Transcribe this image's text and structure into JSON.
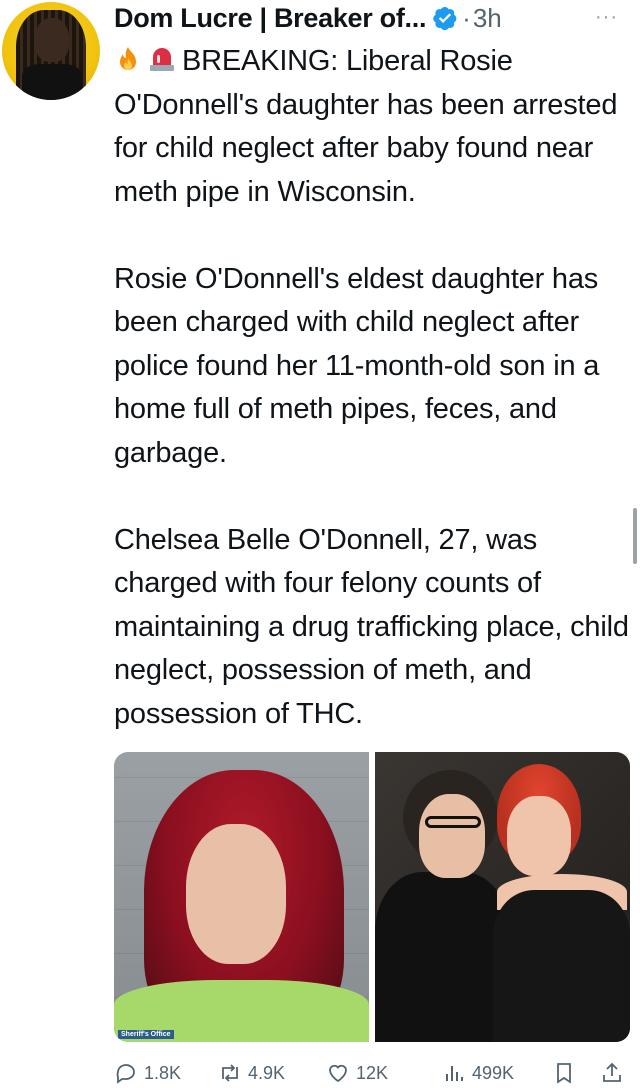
{
  "tweet": {
    "author_name": "Dom Lucre | Breaker of...",
    "separator": "·",
    "timestamp": "3h",
    "more_label": "···",
    "paragraphs": [
      "BREAKING: Liberal Rosie O'Donnell's daughter has been arrested for child neglect after baby found near meth pipe in Wisconsin.",
      "Rosie O'Donnell's eldest daughter has been charged with child neglect after police found her 11-month-old son in a home full of meth pipes, feces, and garbage.",
      "Chelsea Belle O'Donnell, 27, was charged with four felony counts of maintaining a drug trafficking place, child neglect, possession of meth, and possession of THC."
    ],
    "media_caption": "Sheriff's Office"
  },
  "actions": {
    "replies": "1.8K",
    "retweets": "4.9K",
    "likes": "12K",
    "views": "499K"
  },
  "icons": {
    "verified": "verified-badge-icon",
    "fire": "fire-emoji-icon",
    "siren": "siren-emoji-icon",
    "reply": "reply-icon",
    "retweet": "retweet-icon",
    "like": "heart-icon",
    "views": "views-chart-icon",
    "bookmark": "bookmark-icon",
    "share": "share-icon"
  },
  "colors": {
    "text": "#0f1419",
    "muted": "#536471",
    "verified": "#1d9bf0"
  }
}
